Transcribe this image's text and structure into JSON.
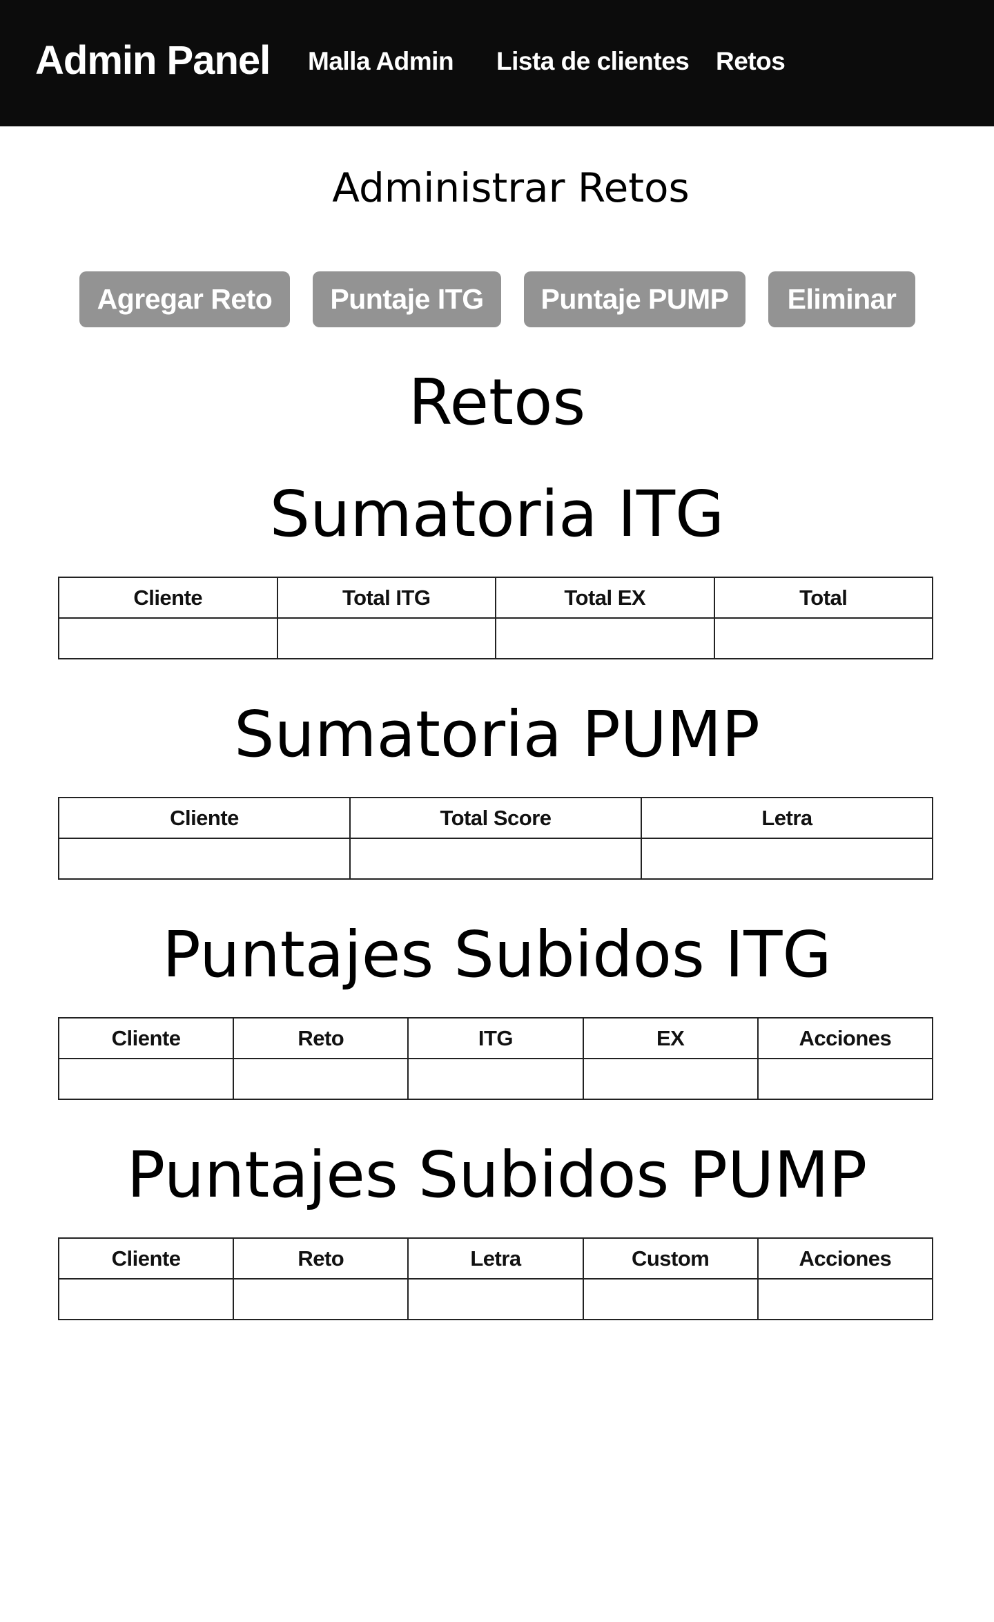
{
  "navbar": {
    "brand": "Admin Panel",
    "links": [
      "Malla Admin",
      "Lista de clientes",
      "Retos"
    ]
  },
  "page": {
    "title": "Administrar Retos"
  },
  "actions": [
    "Agregar Reto",
    "Puntaje ITG",
    "Puntaje PUMP",
    "Eliminar"
  ],
  "retos_heading": "Retos",
  "tables": [
    {
      "title": "Sumatoria ITG",
      "columns": [
        "Cliente",
        "Total ITG",
        "Total EX",
        "Total"
      ]
    },
    {
      "title": "Sumatoria PUMP",
      "columns": [
        "Cliente",
        "Total Score",
        "Letra"
      ]
    },
    {
      "title": "Puntajes Subidos ITG",
      "columns": [
        "Cliente",
        "Reto",
        "ITG",
        "EX",
        "Acciones"
      ]
    },
    {
      "title": "Puntajes Subidos PUMP",
      "columns": [
        "Cliente",
        "Reto",
        "Letra",
        "Custom",
        "Acciones"
      ]
    }
  ],
  "colors": {
    "navbar_bg": "#0c0c0c",
    "button_bg": "#939393",
    "text": "#000000"
  }
}
